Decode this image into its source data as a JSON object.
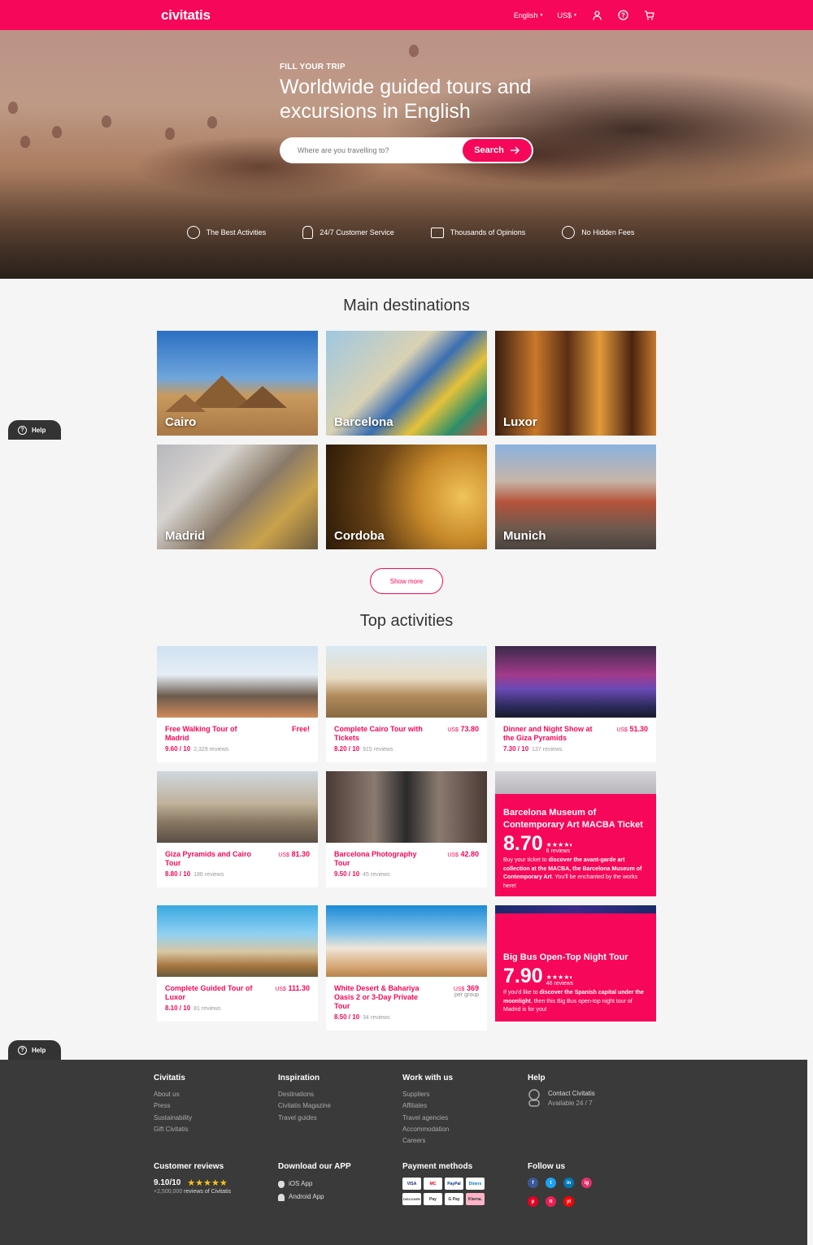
{
  "header": {
    "logo": "civitatis",
    "language": "English",
    "currency": "US$"
  },
  "hero": {
    "kicker": "FILL YOUR TRIP",
    "title": "Worldwide guided tours and excursions in English",
    "search_placeholder": "Where are you travelling to?",
    "search_label": "Search",
    "features": [
      {
        "label": "The Best Activities",
        "icon": "badge-check-icon"
      },
      {
        "label": "24/7 Customer Service",
        "icon": "headset-icon"
      },
      {
        "label": "Thousands of Opinions",
        "icon": "reviews-icon"
      },
      {
        "label": "No Hidden Fees",
        "icon": "dollar-icon"
      }
    ]
  },
  "destinations": {
    "title": "Main destinations",
    "items": [
      "Cairo",
      "Barcelona",
      "Luxor",
      "Madrid",
      "Cordoba",
      "Munich"
    ],
    "show_more": "Show more"
  },
  "activities": {
    "title": "Top activities",
    "cards": [
      {
        "title": "Free Walking Tour of Madrid",
        "price": "Free!",
        "currency": "",
        "score": "9.60 / 10",
        "reviews": "2,329 reviews"
      },
      {
        "title": "Complete Cairo Tour with Tickets",
        "price": "73.80",
        "currency": "US$",
        "score": "8.20 / 10",
        "reviews": "915 reviews"
      },
      {
        "title": "Dinner and Night Show at the Giza Pyramids",
        "price": "51.30",
        "currency": "US$",
        "score": "7.30 / 10",
        "reviews": "137 reviews"
      },
      {
        "title": "Giza Pyramids and Cairo Tour",
        "price": "81.30",
        "currency": "US$",
        "score": "8.80 / 10",
        "reviews": "186 reviews"
      },
      {
        "title": "Barcelona Photography Tour",
        "price": "42.80",
        "currency": "US$",
        "score": "9.50 / 10",
        "reviews": "45 reviews"
      },
      {
        "title": "Complete Guided Tour of Luxor",
        "price": "111.30",
        "currency": "US$",
        "score": "8.10 / 10",
        "reviews": "81 reviews"
      },
      {
        "title": "White Desert & Bahariya Oasis 2 or 3-Day Private Tour",
        "price": "369",
        "currency": "US$",
        "per": "per group",
        "score": "8.50 / 10",
        "reviews": "34 reviews"
      }
    ],
    "promos": [
      {
        "title": "Barcelona Museum of Contemporary Art MACBA Ticket",
        "score": "8.70",
        "stars": "★★★★◐",
        "reviews": "6 reviews",
        "text_a": "Buy your ticket to ",
        "text_b": "discover the avant-garde art collection at the MACBA, the Barcelona Museum of Contemporary Art",
        "text_c": ". You'll be enchanted by the works here!"
      },
      {
        "title": "Big Bus Open-Top Night Tour",
        "score": "7.90",
        "stars": "★★★★◐",
        "reviews": "46 reviews",
        "text_a": "If you'd like to ",
        "text_b": "discover the Spanish capital under the moonlight",
        "text_c": ", then this Big Bus open-top night tour of Madrid is for you!"
      }
    ]
  },
  "help_label": "Help",
  "footer": {
    "civitatis": {
      "title": "Civitatis",
      "links": [
        "About us",
        "Press",
        "Sustainability",
        "Gift Civitatis"
      ]
    },
    "inspiration": {
      "title": "Inspiration",
      "links": [
        "Destinations",
        "Civitatis Magazine",
        "Travel guides"
      ]
    },
    "work": {
      "title": "Work with us",
      "links": [
        "Suppliers",
        "Affiliates",
        "Travel agencies",
        "Accommodation",
        "Careers"
      ]
    },
    "help": {
      "title": "Help",
      "contact": "Contact Civitatis",
      "available": "Available 24 / 7"
    },
    "reviews": {
      "title": "Customer reviews",
      "score": "9.10/10",
      "stars": "★★★★★",
      "count": "+2,500,000",
      "count_suffix": " reviews of Civitatis"
    },
    "app": {
      "title": "Download our APP",
      "ios": "iOS App",
      "android": "Android App"
    },
    "payments": {
      "title": "Payment methods",
      "methods": [
        "VISA",
        "MC",
        "PayPal",
        "Diners",
        "DISCOVER",
        "Pay",
        "G Pay",
        "Klarna."
      ]
    },
    "follow": {
      "title": "Follow us",
      "networks": [
        "f",
        "t",
        "in",
        "ig",
        "p",
        "tt",
        "yt"
      ]
    }
  },
  "colors": {
    "brand": "#f70759",
    "footer_bg": "#3a3a3a"
  }
}
